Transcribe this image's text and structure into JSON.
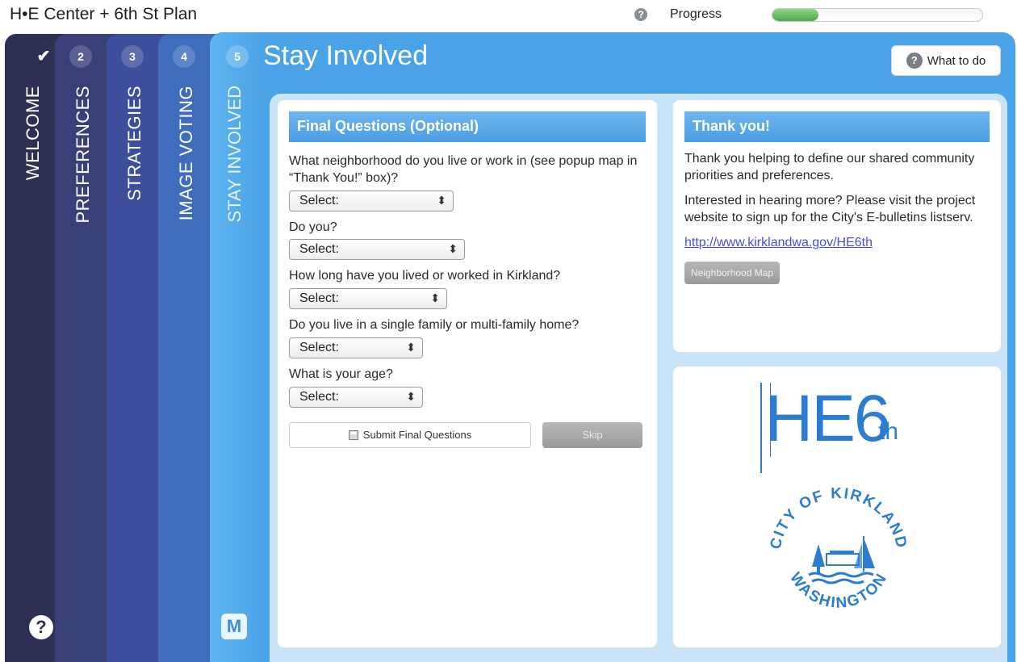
{
  "app": {
    "title": "H•E Center + 6th St Plan"
  },
  "progress": {
    "label": "Progress",
    "value_percent": 22,
    "fill_color": "#49a84a"
  },
  "tabs": [
    {
      "num": "✔",
      "label": "WELCOME",
      "icon": "check-icon"
    },
    {
      "num": "2",
      "label": "PREFERENCES"
    },
    {
      "num": "3",
      "label": "STRATEGIES"
    },
    {
      "num": "4",
      "label": "IMAGE VOTING"
    },
    {
      "num": "5",
      "label": "STAY INVOLVED"
    }
  ],
  "step": {
    "title": "Stay Involved",
    "what_to_do": "What to do"
  },
  "questions": {
    "header": "Final Questions (Optional)",
    "items": [
      {
        "text": "What neighborhood do you live or work in (see popup map in “Thank You!” box)?",
        "value": "Select:"
      },
      {
        "text": "Do you?",
        "value": "Select:"
      },
      {
        "text": "How long have you lived or worked in Kirkland?",
        "value": "Select:"
      },
      {
        "text": "Do you live in a single family or multi-family home?",
        "value": "Select:"
      },
      {
        "text": "What is your age?",
        "value": "Select:"
      }
    ],
    "submit_label": "Submit Final Questions",
    "skip_label": "Skip"
  },
  "thankyou": {
    "header": "Thank you!",
    "p1": "Thank you helping to define our shared community priorities and preferences.",
    "p2": "Interested in hearing more? Please visit the project website to sign up for the City's E-bulletins listserv.",
    "link": "http://www.kirklandwa.gov/HE6th",
    "map_button": "Neighborhood Map"
  },
  "branding": {
    "logo_main": "HE6",
    "logo_sup": "th",
    "seal_top": "CITY OF KIRKLAND",
    "seal_bottom": "WASHINGTON"
  },
  "colors": {
    "tab1": "#2d3055",
    "tab2": "#393f79",
    "tab3": "#3d4f9c",
    "tab4": "#3f6cbb",
    "active": "#4aa3e6",
    "logo_blue": "#2c7ccf"
  }
}
